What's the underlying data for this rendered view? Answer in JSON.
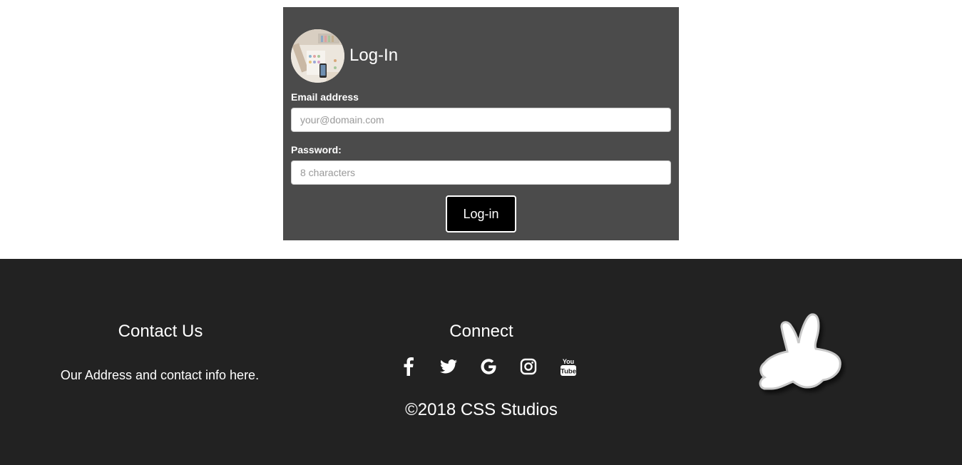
{
  "login": {
    "title": "Log-In",
    "avatar_icon": "photo-avatar",
    "email_label": "Email address",
    "email_placeholder": "your@domain.com",
    "email_value": "",
    "password_label": "Password:",
    "password_placeholder": "8 characters",
    "password_value": "",
    "submit_label": "Log-in"
  },
  "footer": {
    "contact_heading": "Contact Us",
    "contact_info": "Our Address and contact info here.",
    "connect_heading": "Connect",
    "social_icons": [
      "facebook-icon",
      "twitter-icon",
      "google-icon",
      "instagram-icon",
      "youtube-icon"
    ],
    "copyright": "©2018 CSS Studios",
    "logo_icon": "rabbit-logo"
  },
  "colors": {
    "card_bg": "#4b4b4b",
    "footer_bg": "#222222",
    "button_bg": "#000000",
    "text": "#ffffff"
  }
}
